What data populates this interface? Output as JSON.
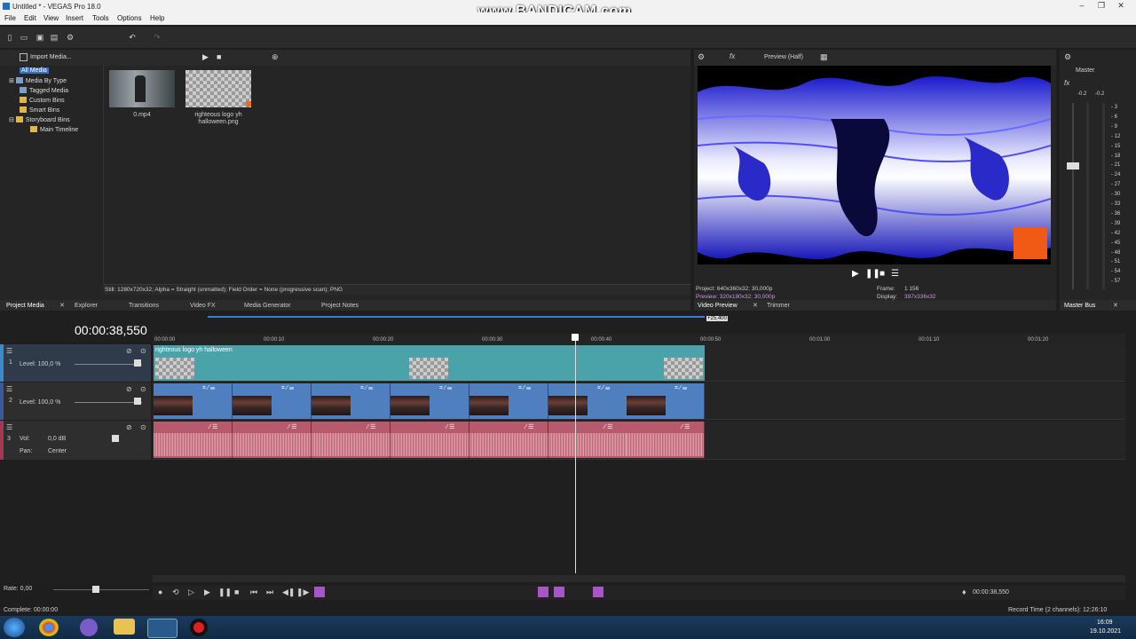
{
  "window": {
    "title": "Untitled * - VEGAS Pro 18.0",
    "watermark": "www.BANDICAM.com"
  },
  "menu": [
    "File",
    "Edit",
    "View",
    "Insert",
    "Tools",
    "Options",
    "Help"
  ],
  "media": {
    "import_label": "Import Media...",
    "tree": [
      "All Media",
      "Media By Type",
      "Tagged Media",
      "Custom Bins",
      "Smart Bins",
      "Storyboard Bins",
      "Main Timeline"
    ],
    "files": [
      {
        "name": "0.mp4"
      },
      {
        "name": "righteous logo yh halloween.png"
      }
    ],
    "status": "Still: 1280x720x32; Alpha = Straight (unmatted); Field Order = None (progressive scan); PNG",
    "tabs": [
      "Project Media",
      "Explorer",
      "Transitions",
      "Video FX",
      "Media Generator",
      "Project Notes"
    ]
  },
  "preview": {
    "mode": "Preview (Half)",
    "project": "Project:  640x360x32; 30,000p",
    "preview_info": "Preview:  320x180x32; 30,000p",
    "frame_label": "Frame:",
    "frame_value": "1 156",
    "display_label": "Display:",
    "display_value": "397x336x32",
    "tabs": [
      "Video Preview",
      "Trimmer"
    ]
  },
  "master": {
    "title": "Master",
    "peak_left": "-0.2",
    "peak_right": "-0.2",
    "scale": [
      "3",
      "6",
      "9",
      "12",
      "15",
      "18",
      "21",
      "24",
      "27",
      "30",
      "33",
      "36",
      "39",
      "42",
      "45",
      "48",
      "51",
      "54",
      "57"
    ],
    "tab": "Master Bus"
  },
  "timeline": {
    "time": "00:00:38,550",
    "marker": "+25,400",
    "ruler": [
      "00:00:00",
      "00:00:10",
      "00:00:20",
      "00:00:30",
      "00:00:40",
      "00:00:50",
      "00:01:00",
      "00:01:10",
      "00:01:20"
    ],
    "tracks": [
      {
        "num": "1",
        "level": "Level: 100,0 %",
        "clip": "righteous logo yh halloween"
      },
      {
        "num": "2",
        "level": "Level: 100,0 %"
      },
      {
        "num": "3",
        "vol_label": "Vol:",
        "vol": "0,0 dB",
        "pan_label": "Pan:",
        "pan": "Center"
      }
    ],
    "rate": "Rate: 0,00",
    "bottom_time": "00:00:38,550",
    "status_left": "Complete: 00:00:00",
    "status_right": "Record Time (2 channels): 12:26:10"
  },
  "clock": {
    "time": "16:09",
    "date": "19.10.2021"
  },
  "colors": {
    "video_track": "#4f7fbf",
    "logo_track": "#4aa3a8",
    "audio_track": "#b85a6e",
    "playhead": "#ffffff"
  }
}
